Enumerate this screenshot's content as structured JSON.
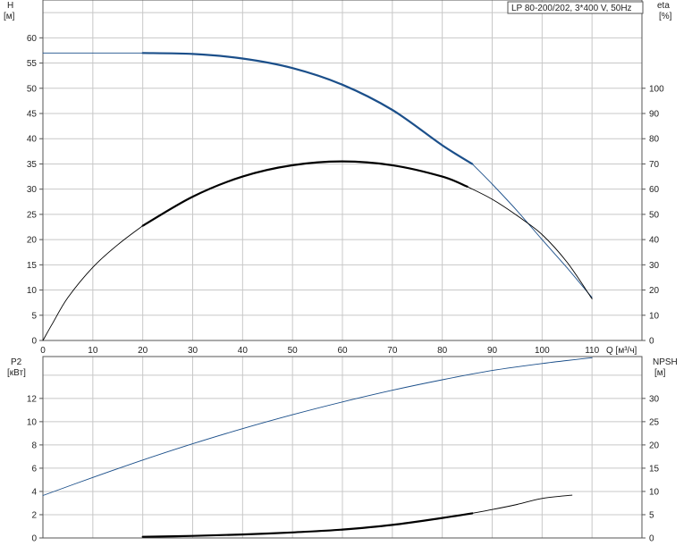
{
  "title_box": "LP 80-200/202, 3*400 V, 50Hz",
  "chart_data": [
    {
      "type": "line",
      "panel": "upper",
      "title": "LP 80-200/202, 3*400 V, 50Hz",
      "xlabel": "Q [м³/ч]",
      "xlim": [
        0,
        120
      ],
      "x_ticks": [
        0,
        10,
        20,
        30,
        40,
        50,
        60,
        70,
        80,
        90,
        100,
        110
      ],
      "left_axis": {
        "label_top": "H",
        "label_unit": "[м]",
        "ylim": [
          0,
          67.5
        ],
        "ticks": [
          0,
          5,
          10,
          15,
          20,
          25,
          30,
          35,
          40,
          45,
          50,
          55,
          60
        ]
      },
      "right_axis": {
        "label_top": "eta",
        "label_unit": "[%]",
        "ylim": [
          0,
          135
        ],
        "ticks": [
          0,
          10,
          20,
          30,
          40,
          50,
          60,
          70,
          80,
          90,
          100
        ]
      },
      "grid": true,
      "series": [
        {
          "axis": "left",
          "color": "#1b4f8a",
          "style": "thin",
          "x": [
            0,
            10,
            20
          ],
          "y": [
            57.0,
            57.0,
            57.0
          ]
        },
        {
          "axis": "left",
          "color": "#1b4f8a",
          "style": "bold",
          "x": [
            20,
            30,
            40,
            50,
            60,
            70,
            80,
            86
          ],
          "y": [
            57.0,
            56.8,
            55.9,
            54.0,
            50.7,
            45.7,
            38.7,
            35.0
          ]
        },
        {
          "axis": "left",
          "color": "#1b4f8a",
          "style": "thin",
          "x": [
            86,
            90,
            95,
            100,
            105,
            110
          ],
          "y": [
            35.0,
            31.0,
            25.7,
            20.0,
            14.4,
            8.5
          ]
        },
        {
          "axis": "right",
          "color": "#000000",
          "style": "thin",
          "x": [
            0,
            2,
            5,
            10,
            15,
            20
          ],
          "y": [
            0,
            7,
            17,
            29,
            38,
            45.5
          ]
        },
        {
          "axis": "right",
          "color": "#000000",
          "style": "bold",
          "x": [
            20,
            30,
            40,
            50,
            60,
            70,
            80,
            85
          ],
          "y": [
            45.5,
            57,
            65,
            69.5,
            71,
            69.5,
            65,
            61
          ]
        },
        {
          "axis": "right",
          "color": "#000000",
          "style": "thin",
          "x": [
            85,
            90,
            95,
            100,
            105,
            110
          ],
          "y": [
            61,
            56,
            49.5,
            42,
            31,
            16.5
          ]
        }
      ]
    },
    {
      "type": "line",
      "panel": "lower",
      "xlim": [
        0,
        120
      ],
      "x_ticks": [
        0,
        10,
        20,
        30,
        40,
        50,
        60,
        70,
        80,
        90,
        100,
        110
      ],
      "left_axis": {
        "label_top": "P2",
        "label_unit": "[кВт]",
        "ylim": [
          0,
          15.6
        ],
        "ticks": [
          0,
          2,
          4,
          6,
          8,
          10,
          12
        ]
      },
      "right_axis": {
        "label_top": "NPSH",
        "label_unit": "[м]",
        "ylim": [
          0,
          39
        ],
        "ticks": [
          0,
          5,
          10,
          15,
          20,
          25,
          30
        ]
      },
      "grid": true,
      "series": [
        {
          "axis": "left",
          "color": "#1b4f8a",
          "style": "thin",
          "x": [
            0,
            10,
            20,
            30,
            40,
            50,
            60,
            70,
            80,
            90,
            100,
            110
          ],
          "y": [
            3.65,
            5.2,
            6.7,
            8.1,
            9.4,
            10.6,
            11.7,
            12.7,
            13.6,
            14.4,
            15.0,
            15.5
          ]
        },
        {
          "axis": "right",
          "color": "#000000",
          "style": "bold",
          "x": [
            20,
            30,
            40,
            50,
            60,
            70,
            80,
            86
          ],
          "y": [
            0.25,
            0.45,
            0.75,
            1.2,
            1.8,
            2.8,
            4.3,
            5.3
          ]
        },
        {
          "axis": "right",
          "color": "#000000",
          "style": "thin",
          "x": [
            86,
            90,
            95,
            100,
            106
          ],
          "y": [
            5.3,
            6.1,
            7.2,
            8.5,
            9.2
          ]
        }
      ]
    }
  ]
}
